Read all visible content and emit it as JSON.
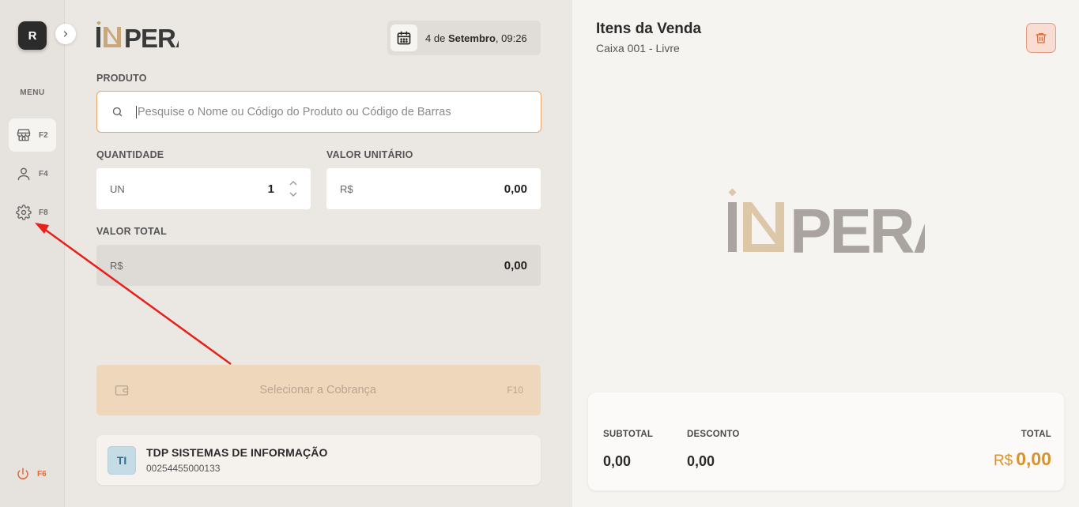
{
  "sidebar": {
    "avatar_initial": "R",
    "menu_label": "MENU",
    "items": [
      {
        "icon": "store-icon",
        "key": "F2"
      },
      {
        "icon": "user-icon",
        "key": "F4"
      },
      {
        "icon": "gear-icon",
        "key": "F8"
      }
    ],
    "power": {
      "icon": "power-icon",
      "key": "F6"
    }
  },
  "header": {
    "brand": "INPERA",
    "date_prefix": "4 de",
    "date_month": "Setembro",
    "date_time": ", 09:26"
  },
  "form": {
    "product_label": "PRODUTO",
    "search_placeholder": "Pesquise o Nome ou Código do Produto ou Código de Barras",
    "quantity_label": "QUANTIDADE",
    "quantity_unit": "UN",
    "quantity_value": "1",
    "unit_price_label": "VALOR UNITÁRIO",
    "currency": "R$",
    "unit_price_value": "0,00",
    "total_label": "VALOR TOTAL",
    "total_value": "0,00"
  },
  "charge": {
    "label": "Selecionar a Cobrança",
    "key": "F10"
  },
  "company": {
    "badge": "TI",
    "name": "TDP SISTEMAS DE INFORMAÇÃO",
    "cnpj": "00254455000133"
  },
  "sale": {
    "title": "Itens da Venda",
    "subtitle": "Caixa 001 - Livre",
    "brand": "INPERA",
    "subtotal_label": "SUBTOTAL",
    "subtotal_value": "0,00",
    "discount_label": "DESCONTO",
    "discount_value": "0,00",
    "total_label": "TOTAL",
    "total_currency": "R$",
    "total_value": "0,00"
  },
  "colors": {
    "accent_orange": "#d8922e",
    "logo_gold": "#c9a77a",
    "logo_gray": "#a9a49f",
    "danger": "#e06a3c"
  }
}
